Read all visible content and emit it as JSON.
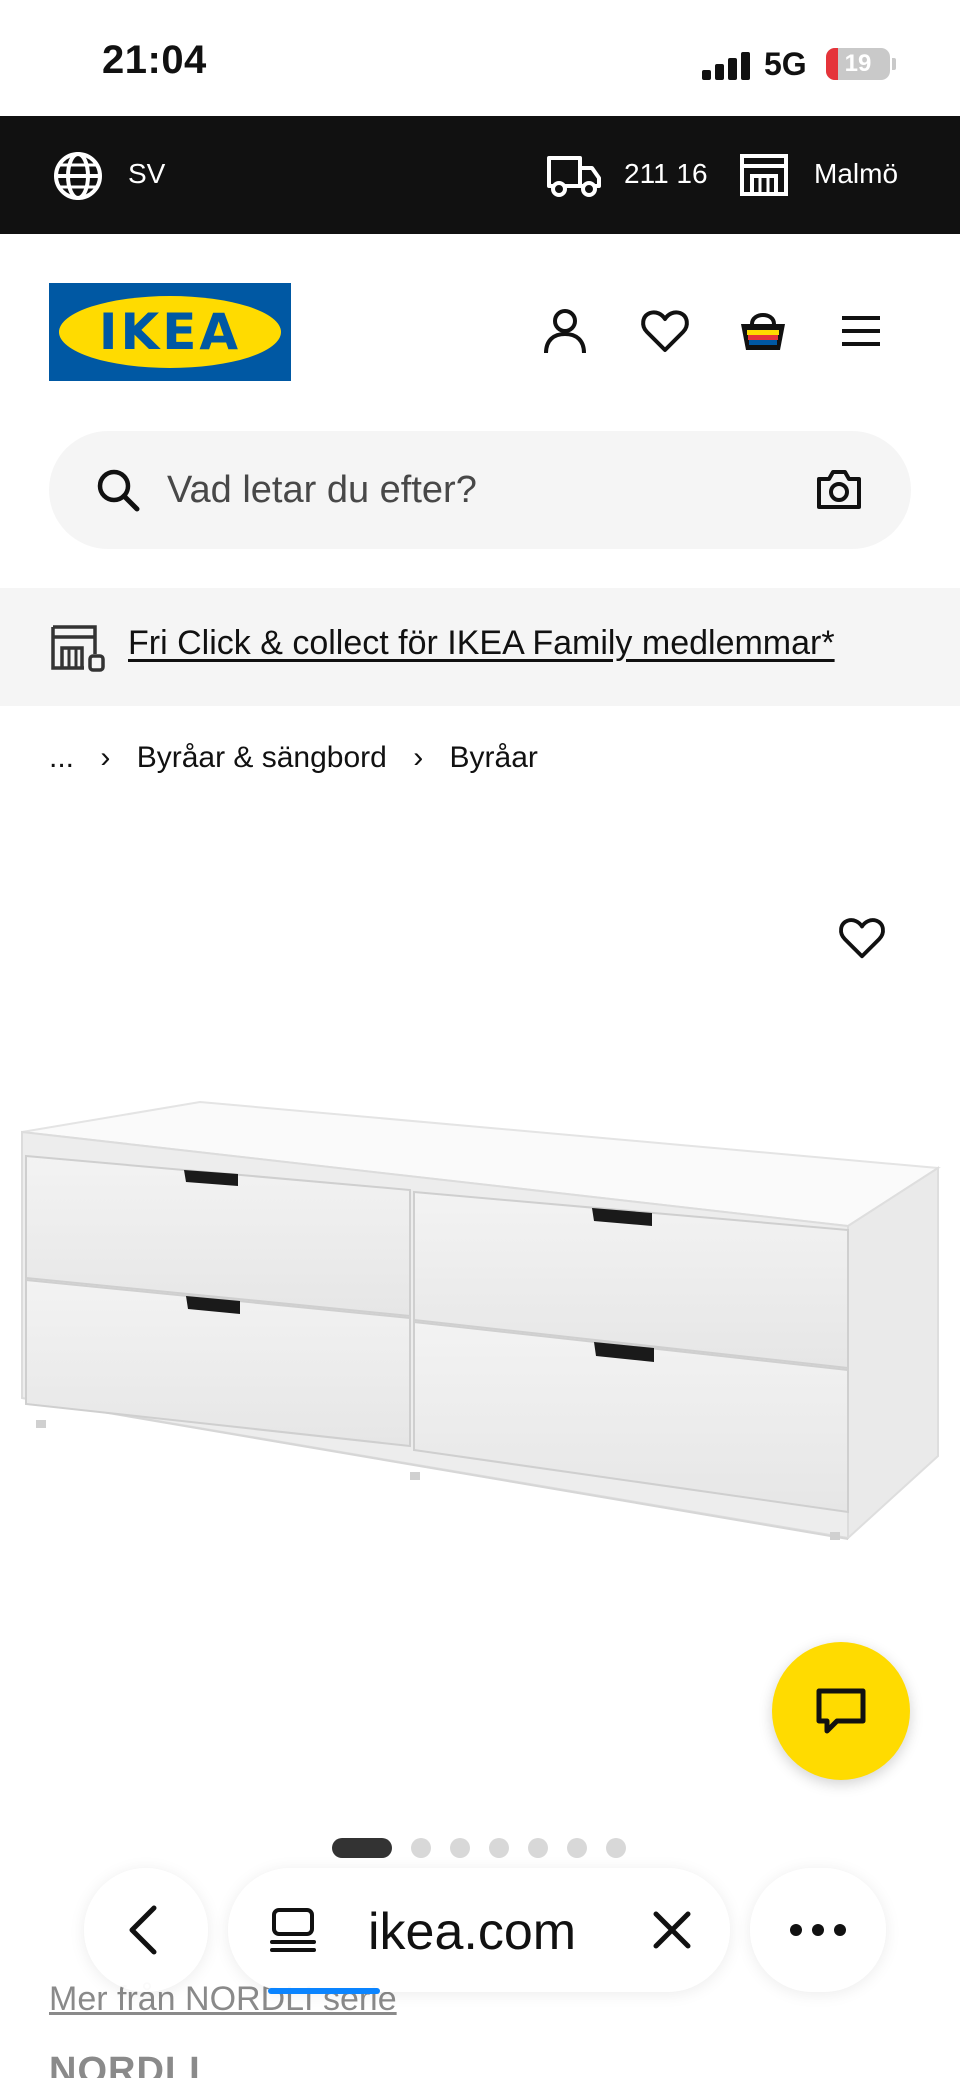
{
  "status_bar": {
    "time": "21:04",
    "network": "5G",
    "battery_level": "19",
    "battery_fraction": 0.19,
    "battery_color": "#e5343a"
  },
  "top_bar": {
    "language": "SV",
    "postal_code": "211 16",
    "store": "Malmö",
    "icons": [
      "globe-icon",
      "truck-icon",
      "store-icon"
    ]
  },
  "header": {
    "logo_text": "IKEA",
    "brand_blue": "#0058a3",
    "brand_yellow": "#ffdb00",
    "icons": [
      "user-icon",
      "heart-icon",
      "basket-icon",
      "menu-icon"
    ]
  },
  "search": {
    "placeholder": "Vad letar du efter?"
  },
  "promo": {
    "text": "Fri Click & collect för IKEA Family medlemmar*"
  },
  "breadcrumb": {
    "ellipsis": "...",
    "items": [
      "Byråar & sängbord",
      "Byråar"
    ]
  },
  "product": {
    "image_count": 7,
    "active_image": 1,
    "series_link": "Mer från NORDLI serie",
    "name": "NORDLI"
  },
  "browser": {
    "url": "ikea.com",
    "accent": "#0a84ff"
  }
}
